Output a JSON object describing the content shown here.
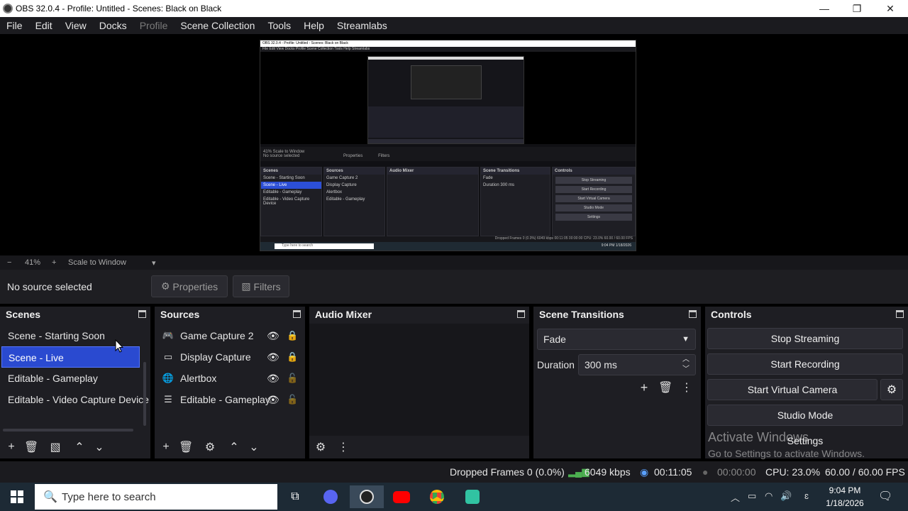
{
  "window": {
    "title": "OBS 32.0.4 - Profile: Untitled - Scenes: Black on Black",
    "minimize": "—",
    "restore": "❐",
    "close": "✕"
  },
  "menu": [
    "File",
    "Edit",
    "View",
    "Docks",
    "Profile",
    "Scene Collection",
    "Tools",
    "Help",
    "Streamlabs"
  ],
  "zoom": {
    "minus": "−",
    "value": "41%",
    "plus": "+",
    "mode": "Scale to Window",
    "arrow": "▾"
  },
  "source_bar": {
    "no_source": "No source selected",
    "properties": "Properties",
    "filters": "Filters"
  },
  "scenes": {
    "title": "Scenes",
    "items": [
      "Scene - Starting Soon",
      "Scene - Live",
      "Editable - Gameplay",
      "Editable - Video Capture Device"
    ],
    "selected_index": 1
  },
  "sources": {
    "title": "Sources",
    "items": [
      {
        "label": "Game Capture 2",
        "icon": "gamepad-icon"
      },
      {
        "label": "Display Capture",
        "icon": "monitor-icon"
      },
      {
        "label": "Alertbox",
        "icon": "globe-icon"
      },
      {
        "label": "Editable - Gameplay",
        "icon": "list-icon"
      }
    ]
  },
  "audio_mixer": {
    "title": "Audio Mixer"
  },
  "transitions": {
    "title": "Scene Transitions",
    "selected": "Fade",
    "duration_label": "Duration",
    "duration_value": "300 ms"
  },
  "controls": {
    "title": "Controls",
    "stop_streaming": "Stop Streaming",
    "start_recording": "Start Recording",
    "start_virtual_camera": "Start Virtual Camera",
    "studio_mode": "Studio Mode",
    "settings": "Settings"
  },
  "watermark": {
    "line1": "Activate Windows",
    "line2": "Go to Settings to activate Windows."
  },
  "status": {
    "dropped_frames": "Dropped Frames 0 (0.0%)",
    "bitrate": "6049 kbps",
    "stream_time": "00:11:05",
    "record_time": "00:00:00",
    "cpu": "CPU: 23.0%",
    "fps": "60.00 / 60.00 FPS"
  },
  "taskbar": {
    "search_placeholder": "Type here to search",
    "time": "9:04 PM",
    "date": "1/18/2026"
  },
  "nested_preview": {
    "title": "OBS 32.0.4 - Profile: Untitled - Scenes: Black on Black",
    "menu": "File  Edit  View  Docks  Profile  Scene Collection  Tools  Help  Streamlabs",
    "zoom": "41%  Scale to Window",
    "no_source": "No source selected",
    "properties": "Properties",
    "filters": "Filters",
    "scenes_title": "Scenes",
    "scenes": [
      "Scene - Starting Soon",
      "Scene - Live",
      "Editable - Gameplay",
      "Editable - Video Capture Device"
    ],
    "sources_title": "Sources",
    "sources": [
      "Game Capture 2",
      "Display Capture",
      "Alertbox",
      "Editable - Gameplay"
    ],
    "mixer_title": "Audio Mixer",
    "transitions_title": "Scene Transitions",
    "transition": "Fade",
    "duration": "Duration   300 ms",
    "controls_title": "Controls",
    "buttons": [
      "Stop Streaming",
      "Start Recording",
      "Start Virtual Camera",
      "Studio Mode",
      "Settings"
    ],
    "status": "Dropped Frames 0 (0.0%)   6049 kbps   00:11:05   00:00:00   CPU: 23.0%   60.00 / 60.00 FPS",
    "search": "Type here to search",
    "clock": "9:04 PM 1/18/2026"
  }
}
